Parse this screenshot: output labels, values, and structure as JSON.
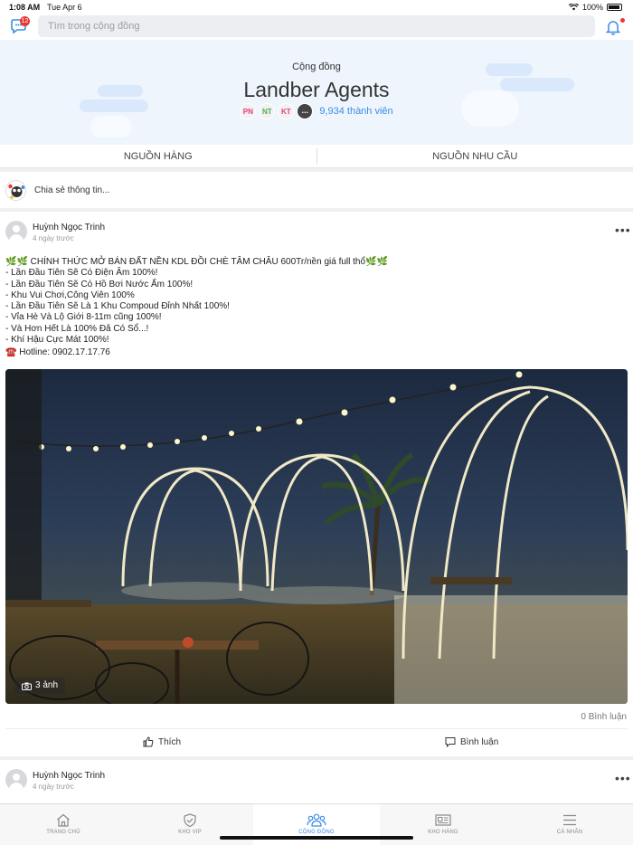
{
  "status": {
    "time": "1:08 AM",
    "date": "Tue Apr 6",
    "battery": "100%"
  },
  "topbar": {
    "chat_badge": "12",
    "search_placeholder": "Tìm trong cộng đồng"
  },
  "header": {
    "label": "Cộng đồng",
    "name": "Landber Agents",
    "member_avatars": [
      "PN",
      "NT",
      "KT",
      "..."
    ],
    "member_count": "9,934 thành viên"
  },
  "tabs": [
    "NGUỒN HÀNG",
    "NGUỒN NHU CẦU"
  ],
  "composer": {
    "placeholder": "Chia sẻ thông tin..."
  },
  "post": {
    "author": "Huỳnh Ngọc Trinh",
    "time": "4 ngày trước",
    "lines": [
      "🌿🌿 CHÍNH THỨC MỞ BÁN ĐẤT NỀN KDL ĐỒI CHÈ TÂM CHÂU 600Tr/nền giá full thổ🌿🌿",
      "- Lần Đầu Tiên Sẽ Có Điện Âm 100%!",
      "- Lần Đầu Tiên Sẽ Có Hồ Bơi Nước Ấm 100%!",
      "- Khu Vui Chơi,Công Viên 100%",
      "- Lần Đầu Tiên Sẽ Là 1 Khu Compoud Đỉnh Nhất 100%!",
      "- Vỉa Hè Và Lộ Giới 8-11m cũng 100%!",
      "- Và Hơn Hết Là 100% Đã Có Sổ...!",
      "- Khí Hậu Cực Mát 100%!",
      "☎️ Hotline: 0902.17.17.76"
    ],
    "photo_count": "3 ảnh",
    "comments": "0 Bình luận",
    "like_label": "Thích",
    "comment_label": "Bình luận"
  },
  "post2": {
    "author": "Huỳnh Ngọc Trinh",
    "time": "4 ngày trước"
  },
  "bottom_nav": [
    "TRANG CHỦ",
    "KHO VIP",
    "CỘNG ĐỒNG",
    "KHO HÀNG",
    "CÁ NHÂN"
  ],
  "colors": {
    "accent": "#3a8ee6",
    "badge": "#e53935",
    "header_bg": "#eef5fd"
  }
}
